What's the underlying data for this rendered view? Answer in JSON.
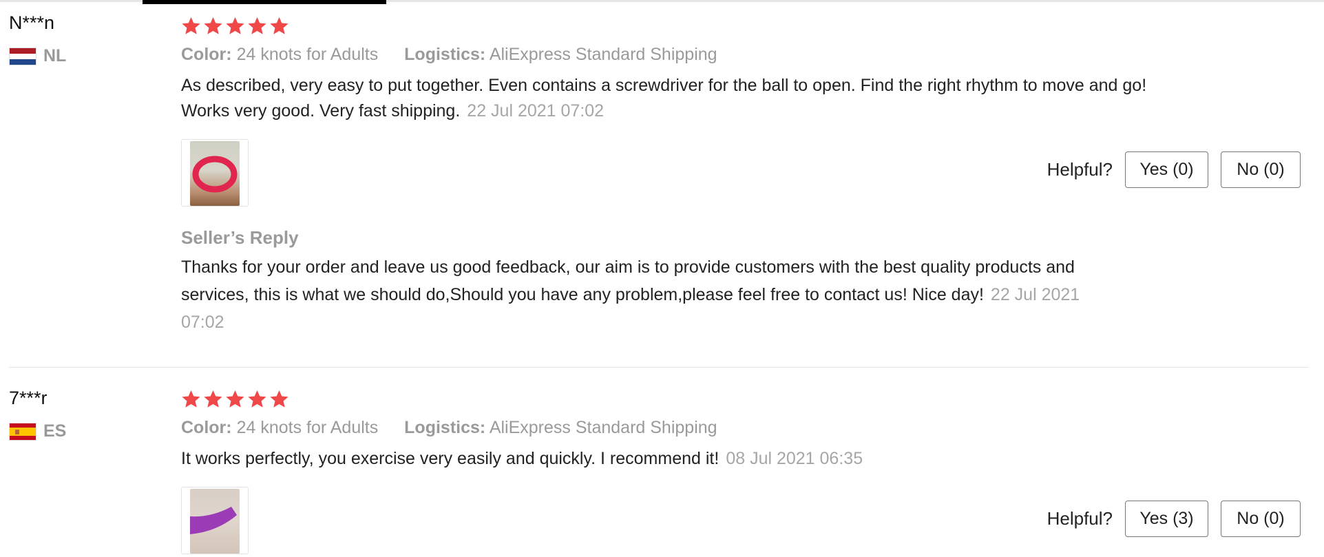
{
  "reviews": [
    {
      "username": "N***n",
      "country_code": "NL",
      "flag_colors": [
        "#ae1c28",
        "#ffffff",
        "#21468b"
      ],
      "rating": 5,
      "color_label": "Color:",
      "color_value": "24 knots for Adults",
      "logistics_label": "Logistics:",
      "logistics_value": "AliExpress Standard Shipping",
      "text": "As described, very easy to put together. Even contains a screwdriver for the ball to open. Find the right rhythm to move and go! Works very good. Very fast shipping.",
      "date": "22 Jul 2021 07:02",
      "helpful_label": "Helpful?",
      "yes_label": "Yes (0)",
      "no_label": "No (0)",
      "seller_reply": {
        "title": "Seller’s Reply",
        "text": "Thanks for your order and leave us good feedback, our aim is to provide customers with the best quality products and services, this is what we should do,Should you have any problem,please feel free to contact us! Nice day!",
        "date": "22 Jul 2021 07:02"
      }
    },
    {
      "username": "7***r",
      "country_code": "ES",
      "flag_colors": [
        "#c60b1e",
        "#ffc400",
        "#c60b1e"
      ],
      "rating": 5,
      "color_label": "Color:",
      "color_value": "24 knots for Adults",
      "logistics_label": "Logistics:",
      "logistics_value": "AliExpress Standard Shipping",
      "text": "It works perfectly, you exercise very easily and quickly. I recommend it!",
      "date": "08 Jul 2021 06:35",
      "helpful_label": "Helpful?",
      "yes_label": "Yes (3)",
      "no_label": "No (0)"
    }
  ],
  "colors": {
    "star": "#f04848",
    "muted_text": "#9a9a9a"
  }
}
